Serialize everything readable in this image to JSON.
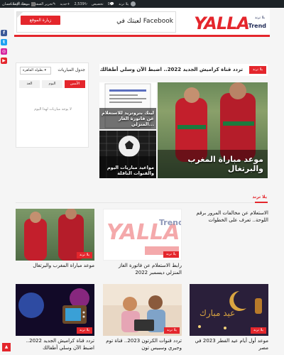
{
  "adminbar": {
    "site": "يلا ترند",
    "comments": "0",
    "updates": "2,539",
    "customize": "تخصيص",
    "new": "جديد",
    "edit": "تحرير الصفحة",
    "ads": "سجة الإعلانات",
    "user": "مرحبًا، أحمد حسان"
  },
  "header": {
    "ad_button": "زيارة الموقع",
    "ad_text": "لعبتك في Facebook",
    "logo_main": "YALLA",
    "logo_sub": "Trend",
    "logo_ar": "يلا ترند"
  },
  "ticker": {
    "tag": "يلا ترند",
    "text": "تردد قناة كراميش الجديد 2022.. اضبط الآن وسلي أطفالك"
  },
  "hero": {
    "main_caption": "موعد مباراة المغرب والبرتغال",
    "item2_caption": "لينك بتروتريد للاستعلام عن فاتورة الغاز المنزلي...",
    "item3_caption": "مواعيد مباريات اليوم والقنوات الناقلة"
  },
  "matches": {
    "title": "جدول المباريات",
    "select": "بطولة القاهرة",
    "tabs": [
      "الأمس",
      "اليوم",
      "الغد"
    ],
    "empty": "لا يوجد مباريات لهذا اليوم"
  },
  "section": {
    "title": "يلا ترند"
  },
  "sidenews": "الاستعلام عن مخالفات المرور برقم اللوحة.. تعرف على الخطوات",
  "cards": [
    {
      "tag": "يلا ترند",
      "title": "رابط الاستعلام عن فاتورة الغاز المنزلي ديسمبر 2022"
    },
    {
      "tag": "يلا ترند",
      "title": "موعد مباراة المغرب والبرتغال"
    },
    {
      "tag": "يلا ترند",
      "title": "موعد أول أيام عيد الفطر 2023 في مصر"
    },
    {
      "tag": "يلا ترند",
      "title": "تردد قنوات الكرتون 2023.. قناة توم وجيري وسبيس تون"
    },
    {
      "tag": "يلا ترند",
      "title": "تردد قناة كراميش الجديد 2022.. اضبط الآن وسلي أطفالك"
    }
  ],
  "colors": {
    "accent": "#e4262c",
    "navy": "#1f2a56"
  }
}
